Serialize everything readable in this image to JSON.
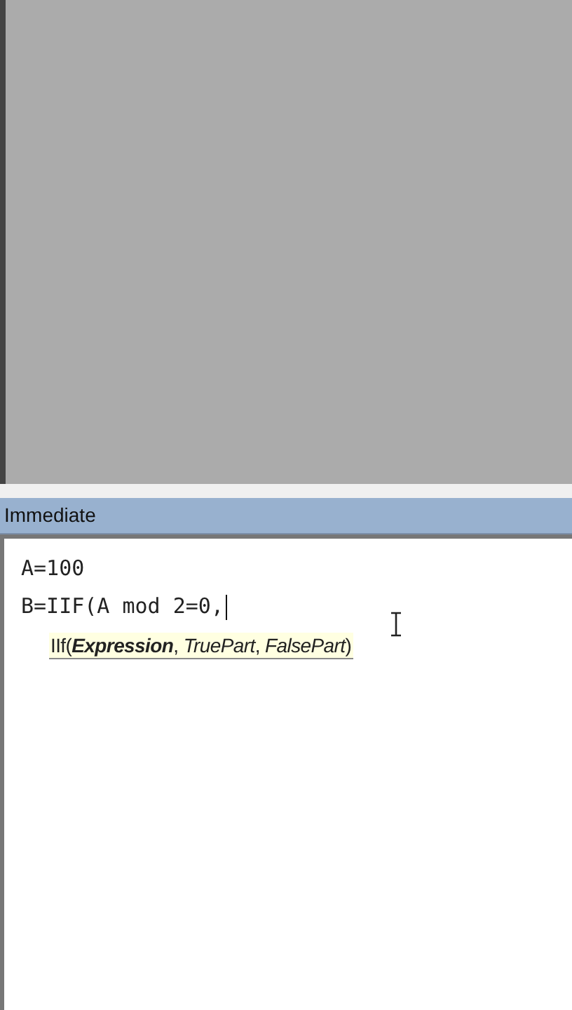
{
  "immediate_window": {
    "title": "Immediate",
    "lines": [
      "A=100",
      "B=IIF(A mod 2=0,"
    ],
    "tooltip": "IIf(**Expression**, *TruePart*, *FalsePart*)"
  }
}
